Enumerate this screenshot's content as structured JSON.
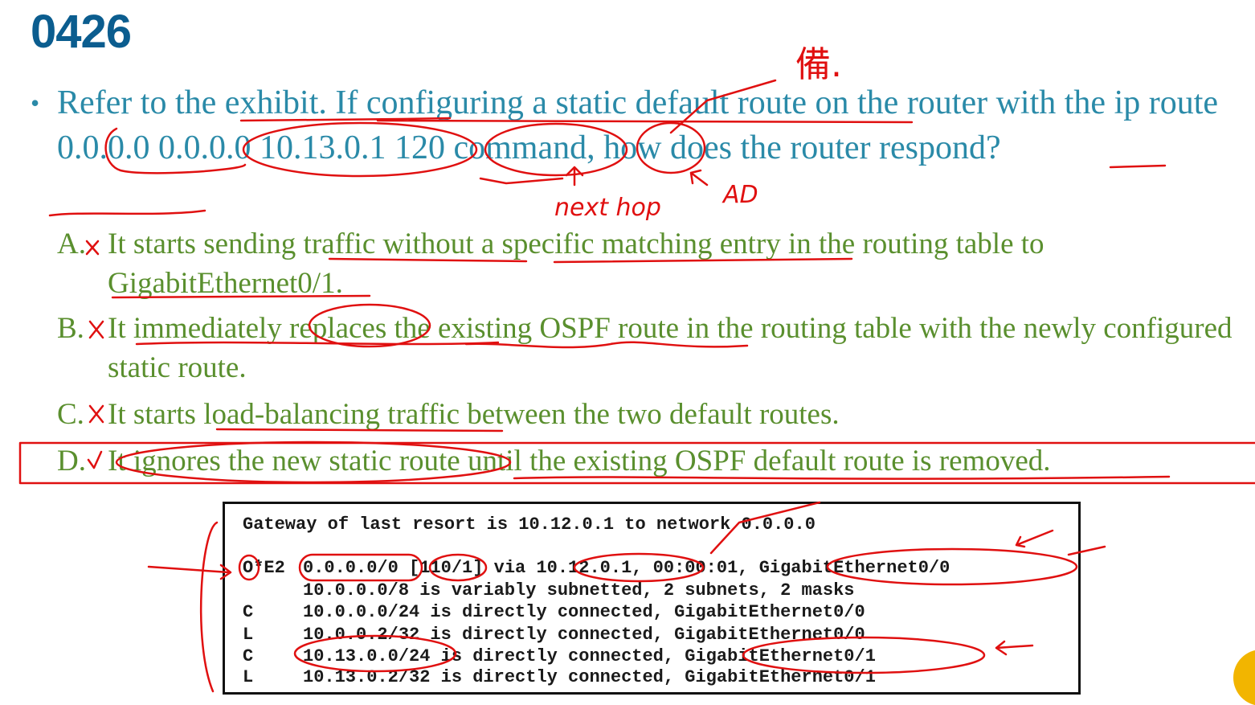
{
  "slide": {
    "title": "0426"
  },
  "question": {
    "bullet": "•",
    "text": "Refer to the exhibit. If configuring a static default route on the router with the ip route 0.0.0.0 0.0.0.0 10.13.0.1 120 command, how does the router respond?"
  },
  "options": [
    {
      "letter": "A.",
      "mark": "✗",
      "text": "It starts sending traffic without a specific matching entry in the routing table to GigabitEthernet0/1."
    },
    {
      "letter": "B.",
      "mark": "✗",
      "text": "It immediately replaces the existing OSPF route in the routing table with the newly configured static route."
    },
    {
      "letter": "C.",
      "mark": "✗",
      "text": "It starts load-balancing traffic between the two default routes."
    },
    {
      "letter": "D.",
      "mark": "✓",
      "text": "It ignores the new static route until the existing OSPF default route is removed."
    }
  ],
  "exhibit": {
    "gateway": "Gateway of last resort is 10.12.0.1 to network 0.0.0.0",
    "rows": [
      {
        "code": "O*E2",
        "route": "0.0.0.0/0 [110/1] via 10.12.0.1, 00:00:01, GigabitEthernet0/0"
      },
      {
        "code": "",
        "route": "10.0.0.0/8 is variably subnetted, 2 subnets, 2 masks"
      },
      {
        "code": "C",
        "route": "10.0.0.0/24 is directly connected, GigabitEthernet0/0"
      },
      {
        "code": "L",
        "route": "10.0.0.2/32 is directly connected, GigabitEthernet0/0"
      },
      {
        "code": "C",
        "route": "10.13.0.0/24 is directly connected, GigabitEthernet0/1"
      },
      {
        "code": "L",
        "route": "10.13.0.2/32 is directly connected, GigabitEthernet0/1"
      }
    ]
  },
  "annotations": {
    "handwritten_top": "備.",
    "next_hop": "next hop",
    "ad": "AD",
    "ink_color": "#e01010"
  },
  "colors": {
    "title": "#0b5d8f",
    "question": "#2a8aa8",
    "options": "#5a8f2e",
    "ink": "#e01010"
  }
}
